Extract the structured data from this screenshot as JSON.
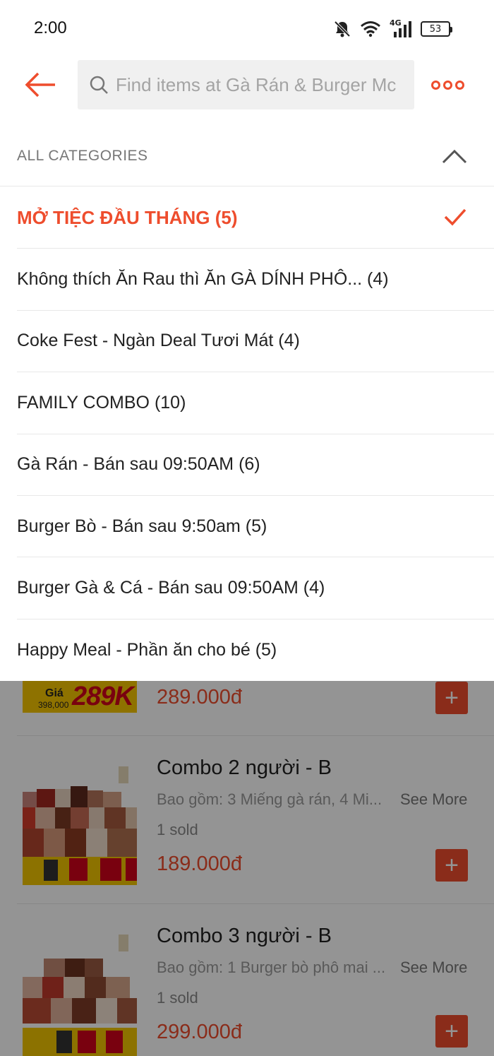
{
  "status_bar": {
    "time": "2:00",
    "network": "4G",
    "battery": "53"
  },
  "header": {
    "search_placeholder": "Find items at Gà Rán & Burger Mc"
  },
  "categories": {
    "title": "ALL CATEGORIES",
    "items": [
      {
        "label": "MỞ TIỆC ĐẦU THÁNG (5)",
        "selected": true
      },
      {
        "label": "Không thích Ăn Rau thì Ăn GÀ DÍNH PHÔ...  (4)",
        "selected": false
      },
      {
        "label": "Coke Fest - Ngàn Deal Tươi Mát (4)",
        "selected": false
      },
      {
        "label": "FAMILY COMBO (10)",
        "selected": false
      },
      {
        "label": "Gà Rán - Bán sau 09:50AM (6)",
        "selected": false
      },
      {
        "label": "Burger Bò - Bán sau 9:50am (5)",
        "selected": false
      },
      {
        "label": "Burger Gà & Cá - Bán sau 09:50AM (4)",
        "selected": false
      },
      {
        "label": "Happy Meal - Phần ăn cho bé (5)",
        "selected": false
      }
    ]
  },
  "menu_items": [
    {
      "price": "289.000đ",
      "banner_label": "Giá",
      "banner_price": "289K",
      "banner_old": "398,000"
    },
    {
      "name": "Combo 2 người - B",
      "description": "Bao gồm: 3 Miếng gà rán, 4 Mi...",
      "see_more": "See More",
      "sold": "1 sold",
      "price": "189.000đ"
    },
    {
      "name": "Combo 3 người - B",
      "description": "Bao gồm: 1 Burger bò phô mai ...",
      "see_more": "See More",
      "sold": "1 sold",
      "price": "299.000đ"
    }
  ],
  "add_label": "+",
  "colors": {
    "accent": "#ee4d2d",
    "overlay": "rgba(0,0,0,0.42)"
  }
}
